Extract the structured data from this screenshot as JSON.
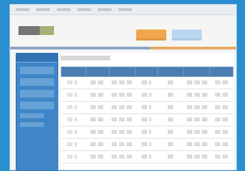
{
  "screen": {
    "frame_color": "#2a8fd0",
    "accent_orange": "#f0a64a",
    "accent_blue": "#4b7db2"
  },
  "app": {
    "menu": [],
    "logo": "",
    "tabs": [
      {
        "label": "",
        "color": "#f0a64a"
      },
      {
        "label": "",
        "color": "#b9d7ee"
      }
    ]
  },
  "sidebar": {
    "items": [
      {
        "label": ""
      },
      {
        "label": ""
      },
      {
        "label": ""
      },
      {
        "label": ""
      },
      {
        "label": ""
      },
      {
        "label": ""
      }
    ]
  },
  "main": {
    "title": "",
    "table": {
      "columns": [
        "",
        "",
        "",
        "",
        "",
        "",
        ""
      ],
      "rows": [
        [
          "",
          "",
          "",
          "",
          "",
          "",
          ""
        ],
        [
          "",
          "",
          "",
          "",
          "",
          "",
          ""
        ],
        [
          "",
          "",
          "",
          "",
          "",
          "",
          ""
        ],
        [
          "",
          "",
          "",
          "",
          "",
          "",
          ""
        ],
        [
          "",
          "",
          "",
          "",
          "",
          "",
          ""
        ],
        [
          "",
          "",
          "",
          "",
          "",
          "",
          ""
        ],
        [
          "",
          "",
          "",
          "",
          "",
          "",
          ""
        ]
      ]
    }
  }
}
